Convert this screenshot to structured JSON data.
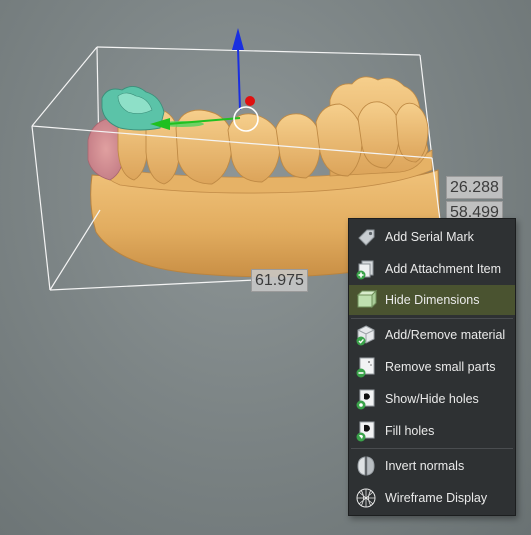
{
  "dimensions": {
    "height_value": "26.288",
    "depth_value": "58.499",
    "width_value": "61.975"
  },
  "context_menu": {
    "items": [
      {
        "label": "Add Serial Mark",
        "icon": "serial-mark-tag-icon"
      },
      {
        "label": "Add Attachment Item",
        "icon": "attachment-item-icon"
      },
      {
        "label": "Hide Dimensions",
        "icon": "dimensions-box-icon",
        "active": true
      },
      {
        "label": "Add/Remove material",
        "icon": "material-cube-icon"
      },
      {
        "label": "Remove small parts",
        "icon": "remove-parts-icon"
      },
      {
        "label": "Show/Hide holes",
        "icon": "holes-eye-icon"
      },
      {
        "label": "Fill holes",
        "icon": "fill-holes-icon"
      },
      {
        "label": "Invert normals",
        "icon": "invert-normals-icon"
      },
      {
        "label": "Wireframe Display",
        "icon": "wireframe-mesh-icon"
      }
    ]
  },
  "colors": {
    "model_gold": "#e9b668",
    "menu_bg": "#2e3133",
    "menu_highlight": "#4a5330",
    "gizmo_blue": "#1a2fe0",
    "gizmo_red": "#e01010",
    "gizmo_green": "#20c020"
  }
}
